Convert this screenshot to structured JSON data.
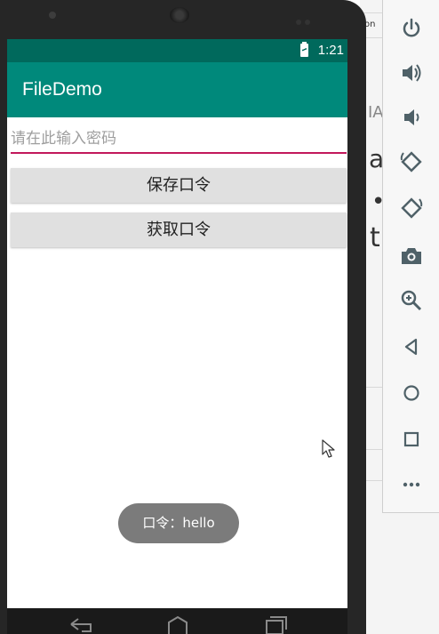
{
  "status_bar": {
    "time": "1:21",
    "battery_icon": "battery-charging-icon"
  },
  "app_bar": {
    "title": "FileDemo",
    "color": "#00897b",
    "status_color": "#00695c"
  },
  "password_input": {
    "placeholder": "请在此输入密码",
    "value": "",
    "underline_color": "#c2185b"
  },
  "buttons": {
    "save": "保存口令",
    "load": "获取口令"
  },
  "toast": {
    "text": "口令：hello"
  },
  "nav_bar": {
    "icons": [
      "back-icon",
      "home-icon",
      "recents-icon"
    ]
  },
  "emulator_toolbar": {
    "items": [
      "power-icon",
      "volume-up-icon",
      "volume-down-icon",
      "rotate-left-icon",
      "rotate-right-icon",
      "camera-icon",
      "zoom-icon",
      "back-icon",
      "home-icon",
      "overview-icon",
      "more-icon"
    ]
  },
  "background_text": {
    "top": "on",
    "a1": "IA",
    "a2": "a",
    "a3": "•",
    "a4": "t"
  }
}
